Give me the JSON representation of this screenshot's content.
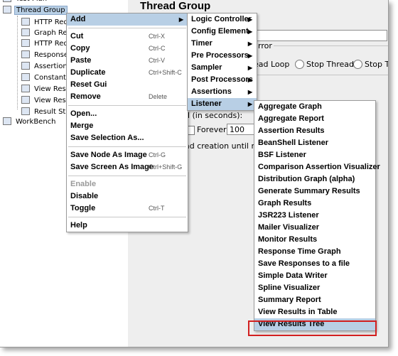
{
  "tree": {
    "items": [
      {
        "label": "Test Plan",
        "selected": false
      },
      {
        "label": "Thread Group",
        "selected": true
      },
      {
        "label": "HTTP Requ",
        "selected": false
      },
      {
        "label": "Graph Res",
        "selected": false
      },
      {
        "label": "HTTP Requ",
        "selected": false
      },
      {
        "label": "Response",
        "selected": false
      },
      {
        "label": "Assertion",
        "selected": false
      },
      {
        "label": "Constant T",
        "selected": false
      },
      {
        "label": "View Res",
        "selected": false
      },
      {
        "label": "View Res",
        "selected": false
      },
      {
        "label": "Result Sta",
        "selected": false
      },
      {
        "label": "WorkBench",
        "selected": false
      }
    ]
  },
  "panel": {
    "title": "Thread Group",
    "error_legend": "rror",
    "radios": [
      "ead Loop",
      "Stop Thread",
      "Stop T"
    ],
    "loop_label": "d (in seconds):",
    "forever_label": "Forever",
    "loop_value": "100",
    "delay_label": "ad creation until ne"
  },
  "context_menu": {
    "items": [
      {
        "label": "Add",
        "shortcut": "",
        "submenu": true,
        "highlighted": true,
        "disabled": false
      },
      {
        "sep": true
      },
      {
        "label": "Cut",
        "shortcut": "Ctrl-X"
      },
      {
        "label": "Copy",
        "shortcut": "Ctrl-C"
      },
      {
        "label": "Paste",
        "shortcut": "Ctrl-V"
      },
      {
        "label": "Duplicate",
        "shortcut": "Ctrl+Shift-C"
      },
      {
        "label": "Reset Gui",
        "shortcut": ""
      },
      {
        "label": "Remove",
        "shortcut": "Delete"
      },
      {
        "sep": true
      },
      {
        "label": "Open...",
        "shortcut": ""
      },
      {
        "label": "Merge",
        "shortcut": ""
      },
      {
        "label": "Save Selection As...",
        "shortcut": ""
      },
      {
        "sep": true
      },
      {
        "label": "Save Node As Image",
        "shortcut": "Ctrl-G"
      },
      {
        "label": "Save Screen As Image",
        "shortcut": "Ctrl+Shift-G"
      },
      {
        "sep": true
      },
      {
        "label": "Enable",
        "shortcut": "",
        "disabled": true
      },
      {
        "label": "Disable",
        "shortcut": ""
      },
      {
        "label": "Toggle",
        "shortcut": "Ctrl-T"
      },
      {
        "sep": true
      },
      {
        "label": "Help",
        "shortcut": ""
      }
    ]
  },
  "add_menu": {
    "items": [
      {
        "label": "Logic Controller",
        "submenu": true
      },
      {
        "label": "Config Element",
        "submenu": true
      },
      {
        "label": "Timer",
        "submenu": true
      },
      {
        "label": "Pre Processors",
        "submenu": true
      },
      {
        "label": "Sampler",
        "submenu": true
      },
      {
        "label": "Post Processors",
        "submenu": true
      },
      {
        "label": "Assertions",
        "submenu": true
      },
      {
        "label": "Listener",
        "submenu": true,
        "highlighted": true
      }
    ]
  },
  "listener_menu": {
    "items": [
      "Aggregate Graph",
      "Aggregate Report",
      "Assertion Results",
      "BeanShell Listener",
      "BSF Listener",
      "Comparison Assertion Visualizer",
      "Distribution Graph (alpha)",
      "Generate Summary Results",
      "Graph Results",
      "JSR223 Listener",
      "Mailer Visualizer",
      "Monitor Results",
      "Response Time Graph",
      "Save Responses to a file",
      "Simple Data Writer",
      "Spline Visualizer",
      "Summary Report",
      "View Results in Table",
      "View Results Tree"
    ],
    "highlighted": "View Results Tree"
  },
  "colors": {
    "highlight": "#b8cfe5",
    "callout": "#d21f1f"
  }
}
